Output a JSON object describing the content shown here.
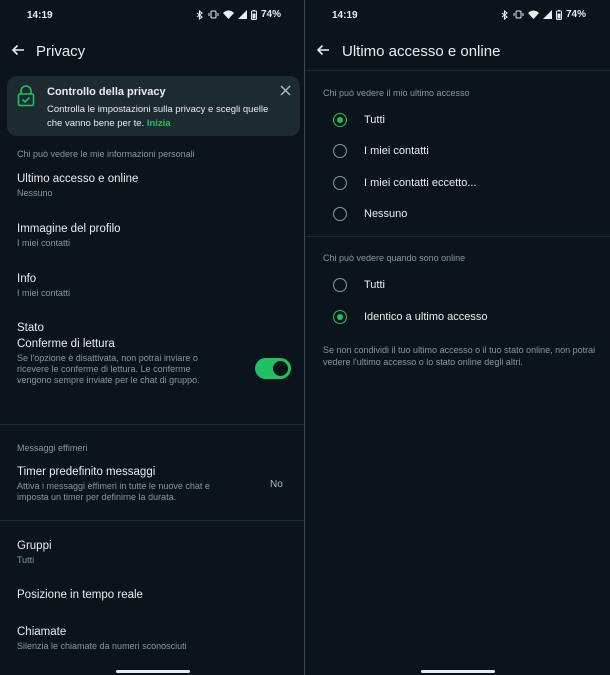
{
  "status_bar": {
    "time": "14:19",
    "battery": "74%"
  },
  "left": {
    "title": "Privacy",
    "banner": {
      "title": "Controllo della privacy",
      "text": "Controlla le impostazioni sulla privacy e scegli quelle che vanno bene per te.",
      "link": "Inizia"
    },
    "section_personal": "Chi può vedere le mie informazioni personali",
    "rows": [
      {
        "title": "Ultimo accesso e online",
        "subtitle": "Nessuno"
      },
      {
        "title": "Immagine del profilo",
        "subtitle": "I miei contatti"
      },
      {
        "title": "Info",
        "subtitle": "I miei contatti"
      },
      {
        "title": "Stato",
        "subtitle": ""
      },
      {
        "title": "Conferme di lettura",
        "subtitle": "Se l'opzione è disattivata, non potrai inviare o ricevere le conferme di lettura. Le conferme vengono sempre inviate per le chat di gruppo.",
        "toggle": "on"
      }
    ],
    "section_ephemeral": "Messaggi effimeri",
    "timer": {
      "title": "Timer predefinito messaggi",
      "subtitle": "Attiva i messaggi effimeri in tutte le nuove chat e imposta un timer per definirne la durata.",
      "value": "No"
    },
    "rows2": [
      {
        "title": "Gruppi",
        "subtitle": "Tutti"
      },
      {
        "title": "Posizione in tempo reale",
        "subtitle": ""
      },
      {
        "title": "Chiamate",
        "subtitle": "Silenzia le chiamate da numeri sconosciuti"
      }
    ]
  },
  "right": {
    "title": "Ultimo accesso e online",
    "section_last_seen": "Chi può vedere il mio ultimo accesso",
    "last_seen_options": [
      {
        "label": "Tutti",
        "selected": true
      },
      {
        "label": "I miei contatti",
        "selected": false
      },
      {
        "label": "I miei contatti eccetto...",
        "selected": false
      },
      {
        "label": "Nessuno",
        "selected": false
      }
    ],
    "section_online": "Chi può vedere quando sono online",
    "online_options": [
      {
        "label": "Tutti",
        "selected": false
      },
      {
        "label": "Identico a ultimo accesso",
        "selected": true
      }
    ],
    "note": "Se non condividi il tuo ultimo accesso o il tuo stato online, non potrai vedere l'ultimo accesso o lo stato online degli altri."
  },
  "colors": {
    "accent": "#21c063",
    "background": "#0b141a",
    "banner": "#1d2a30",
    "secondary_text": "#8696a0"
  }
}
